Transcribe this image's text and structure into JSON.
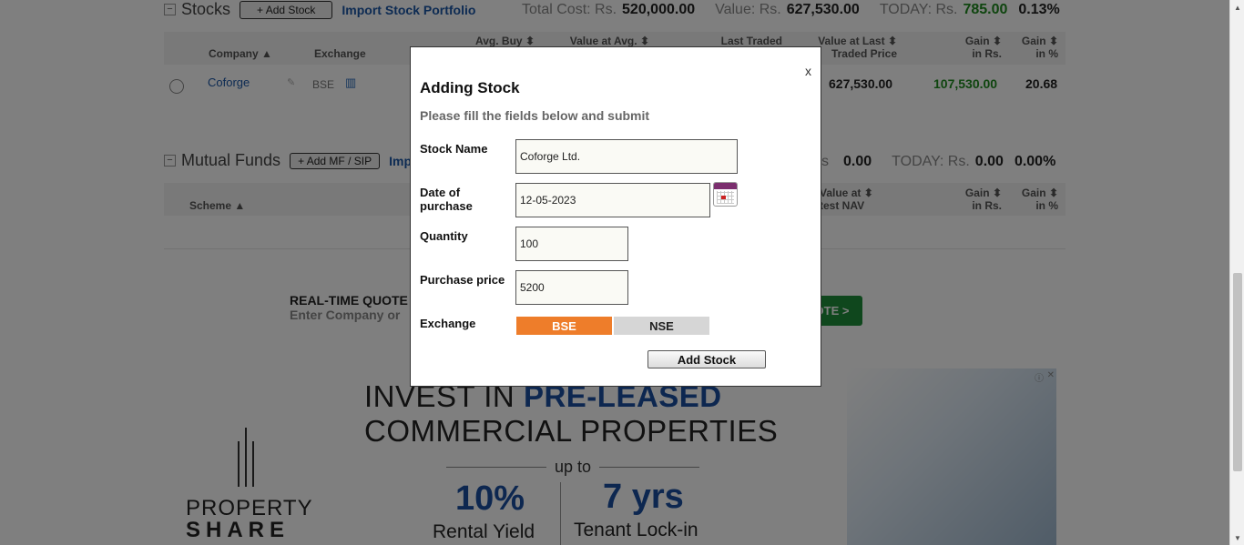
{
  "stocks": {
    "title": "Stocks",
    "add_label": "+ Add Stock",
    "import_label": "Import Stock Portfolio",
    "summary": {
      "total_cost_label": "Total Cost: Rs.",
      "total_cost": "520,000.00",
      "value_label": "Value: Rs.",
      "value": "627,530.00",
      "today_label": "TODAY: Rs.",
      "today": "785.00",
      "today_pct": "0.13%"
    },
    "columns": {
      "company": "Company",
      "exchange": "Exchange",
      "avg_buy": "Avg. Buy",
      "value_at_avg": "Value at Avg.",
      "last_traded": "Last Traded",
      "value_last_1": "Value at Last",
      "value_last_2": "Traded Price",
      "gain_rs_1": "Gain",
      "gain_rs_2": "in Rs.",
      "gain_pct_1": "Gain",
      "gain_pct_2": "in %"
    },
    "row": {
      "company": "Coforge",
      "exchange": "BSE",
      "value_last": "627,530.00",
      "gain_rs": "107,530.00",
      "gain_pct": "20.68"
    }
  },
  "mutual_funds": {
    "title": "Mutual Funds",
    "add_label": "+ Add MF / SIP",
    "import_label": "Imp",
    "summary": {
      "value_label": "s",
      "value": "0.00",
      "today_label": "TODAY: Rs.",
      "today": "0.00",
      "today_pct": "0.00%"
    },
    "columns": {
      "scheme": "Scheme",
      "value_nav_1": "Value at",
      "value_nav_2": "test NAV",
      "gain_rs_1": "Gain",
      "gain_rs_2": "in Rs.",
      "gain_pct_1": "Gain",
      "gain_pct_2": "in %"
    }
  },
  "quote": {
    "line1": "REAL-TIME QUOTE",
    "line2": "Enter Company or",
    "button": "OTE >"
  },
  "ad": {
    "line1_a": "INVEST IN ",
    "line1_b": "PRE-LEASED",
    "line2": "COMMERCIAL PROPERTIES",
    "upto": "up to",
    "big1": "10%",
    "big2": "7 yrs",
    "sub1": "Rental Yield",
    "sub2": "Tenant Lock-in",
    "logo_1": "PROPERTY",
    "logo_2": "SHARE"
  },
  "modal": {
    "close": "x",
    "title": "Adding Stock",
    "subtitle": "Please fill the fields below and submit",
    "stock_name_label": "Stock Name",
    "stock_name_value": "Coforge Ltd.",
    "date_label_1": "Date of",
    "date_label_2": "purchase",
    "date_value": "12-05-2023",
    "quantity_label": "Quantity",
    "quantity_value": "100",
    "price_label": "Purchase price",
    "price_value": "5200",
    "exchange_label": "Exchange",
    "exchange_bse": "BSE",
    "exchange_nse": "NSE",
    "submit_label": "Add Stock"
  }
}
